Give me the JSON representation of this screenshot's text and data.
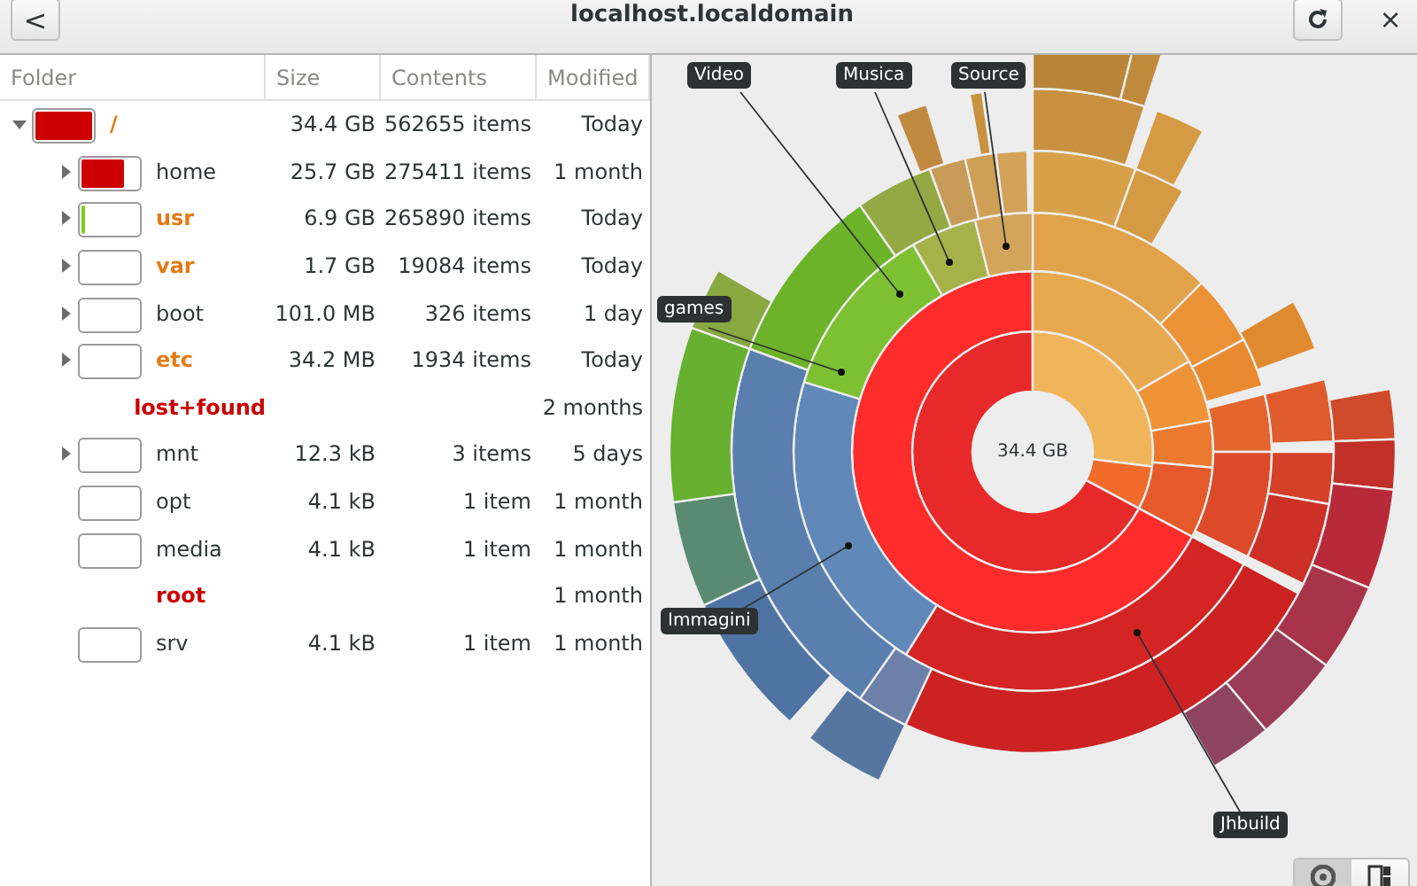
{
  "header": {
    "title": "localhost.localdomain",
    "back_button": "<",
    "close_button": "×"
  },
  "table": {
    "columns": [
      "Folder",
      "Size",
      "Contents",
      "Modified"
    ],
    "rows": [
      {
        "name": "/",
        "color": "#e37b15",
        "size": "34.4 GB",
        "contents": "562655 items",
        "modified": "Today",
        "expandable": true,
        "expanded": true,
        "level": 1,
        "children": [
          {
            "name": "home",
            "color": "#2e3436",
            "size": "25.7 GB",
            "contents": "275411 items",
            "modified": "1 month",
            "expandable": true,
            "expanded": false,
            "level": 0.75
          },
          {
            "name": "usr",
            "color": "#e37b15",
            "size": "6.9 GB",
            "contents": "265890 items",
            "modified": "Today",
            "expandable": true,
            "expanded": false,
            "level": 0.05
          },
          {
            "name": "var",
            "color": "#e37b15",
            "size": "1.7 GB",
            "contents": "19084 items",
            "modified": "Today",
            "expandable": true,
            "expanded": false
          },
          {
            "name": "boot",
            "color": "#2e3436",
            "size": "101.0 MB",
            "contents": "326 items",
            "modified": "1 day",
            "expandable": true,
            "expanded": false
          },
          {
            "name": "etc",
            "color": "#e37b15",
            "size": "34.2 MB",
            "contents": "1934 items",
            "modified": "Today",
            "expandable": true,
            "expanded": false
          },
          {
            "name": "lost+found",
            "color": "#cc0000",
            "modified": "2 months",
            "expandable": false
          },
          {
            "name": "mnt",
            "color": "#2e3436",
            "size": "12.3 kB",
            "contents": "3 items",
            "modified": "5 days",
            "expandable": true,
            "expanded": false
          },
          {
            "name": "opt",
            "color": "#2e3436",
            "size": "4.1 kB",
            "contents": "1 item",
            "modified": "1 month",
            "expandable": false
          },
          {
            "name": "media",
            "color": "#2e3436",
            "size": "4.1 kB",
            "contents": "1 item",
            "modified": "1 month",
            "expandable": false
          },
          {
            "name": "root",
            "color": "#cc0000",
            "modified": "1 month",
            "expandable": false
          },
          {
            "name": "srv",
            "color": "#2e3436",
            "size": "4.1 kB",
            "contents": "1 item",
            "modified": "1 month",
            "expandable": false
          }
        ]
      }
    ]
  },
  "chart": {
    "total": "34.4 GB",
    "labels": [
      "Video",
      "Musica",
      "Source",
      "games",
      "Immagini",
      "Jhbuild"
    ]
  },
  "view_toggle": [
    {
      "kind": "rings",
      "selected": true
    },
    {
      "kind": "treemap",
      "selected": false
    }
  ]
}
